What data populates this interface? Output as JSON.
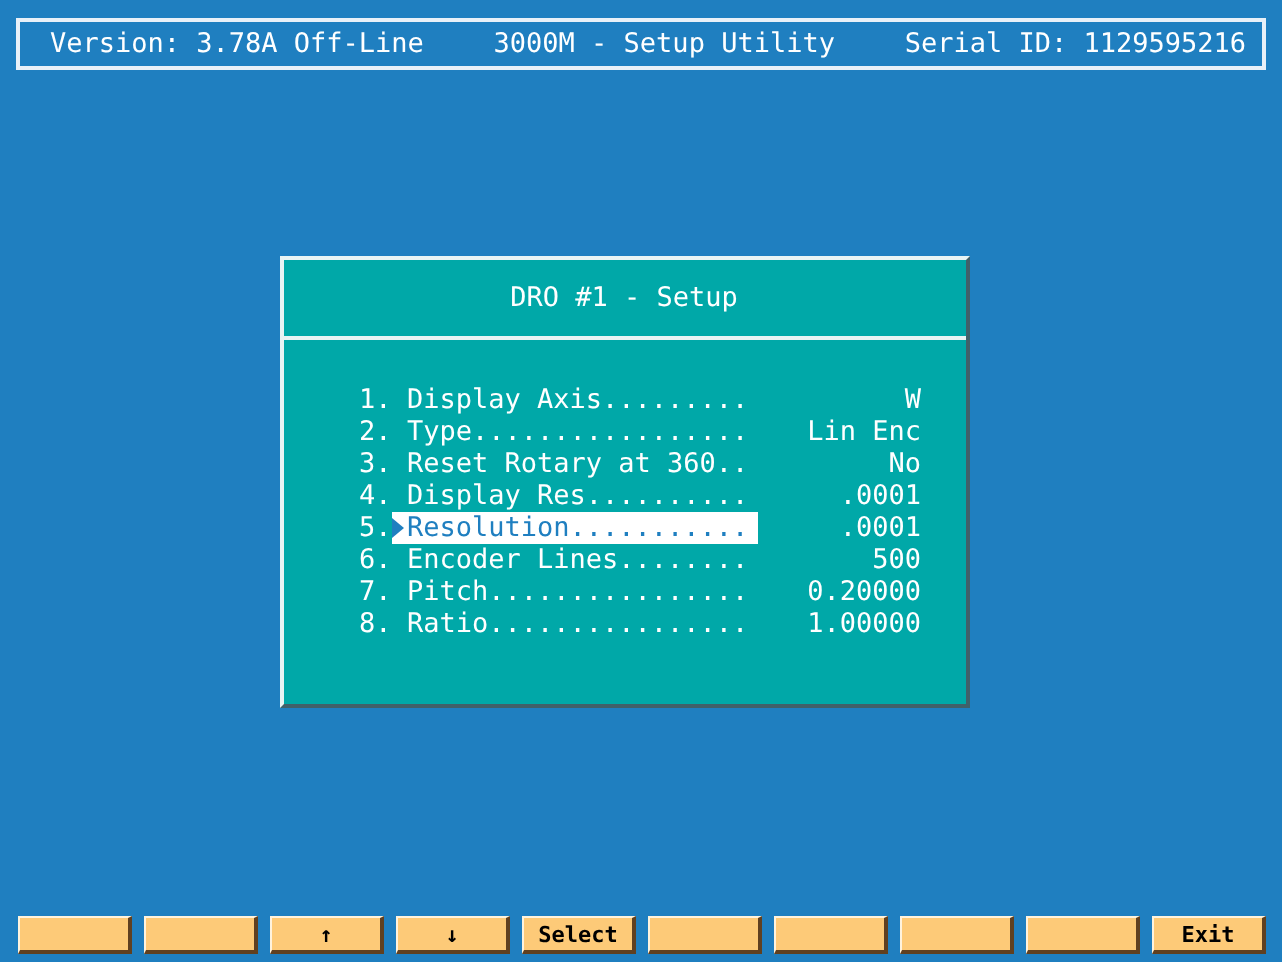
{
  "header": {
    "version": "Version: 3.78A Off-Line",
    "title": "3000M - Setup Utility",
    "serial": "Serial ID: 1129595216"
  },
  "dialog": {
    "title": "DRO #1 - Setup",
    "items": [
      {
        "number": "1.",
        "label": "Display Axis.........",
        "value": "W",
        "selected": false
      },
      {
        "number": "2.",
        "label": "Type.................",
        "value": "Lin Enc",
        "selected": false
      },
      {
        "number": "3.",
        "label": "Reset Rotary at 360..",
        "value": "No",
        "selected": false
      },
      {
        "number": "4.",
        "label": "Display Res..........",
        "value": ".0001",
        "selected": false
      },
      {
        "number": "5.",
        "label": "Resolution...........",
        "value": ".0001",
        "selected": true
      },
      {
        "number": "6.",
        "label": "Encoder Lines........",
        "value": "500",
        "selected": false
      },
      {
        "number": "7.",
        "label": "Pitch................",
        "value": "0.20000",
        "selected": false
      },
      {
        "number": "8.",
        "label": "Ratio................",
        "value": "1.00000",
        "selected": false
      }
    ]
  },
  "function_keys": [
    {
      "kind": "blank"
    },
    {
      "kind": "blank"
    },
    {
      "kind": "label",
      "label": "↑"
    },
    {
      "kind": "label",
      "label": "↓"
    },
    {
      "kind": "label",
      "label": "Select"
    },
    {
      "kind": "blank"
    },
    {
      "kind": "blank"
    },
    {
      "kind": "blank"
    },
    {
      "kind": "blank"
    },
    {
      "kind": "label",
      "label": "Exit"
    }
  ]
}
